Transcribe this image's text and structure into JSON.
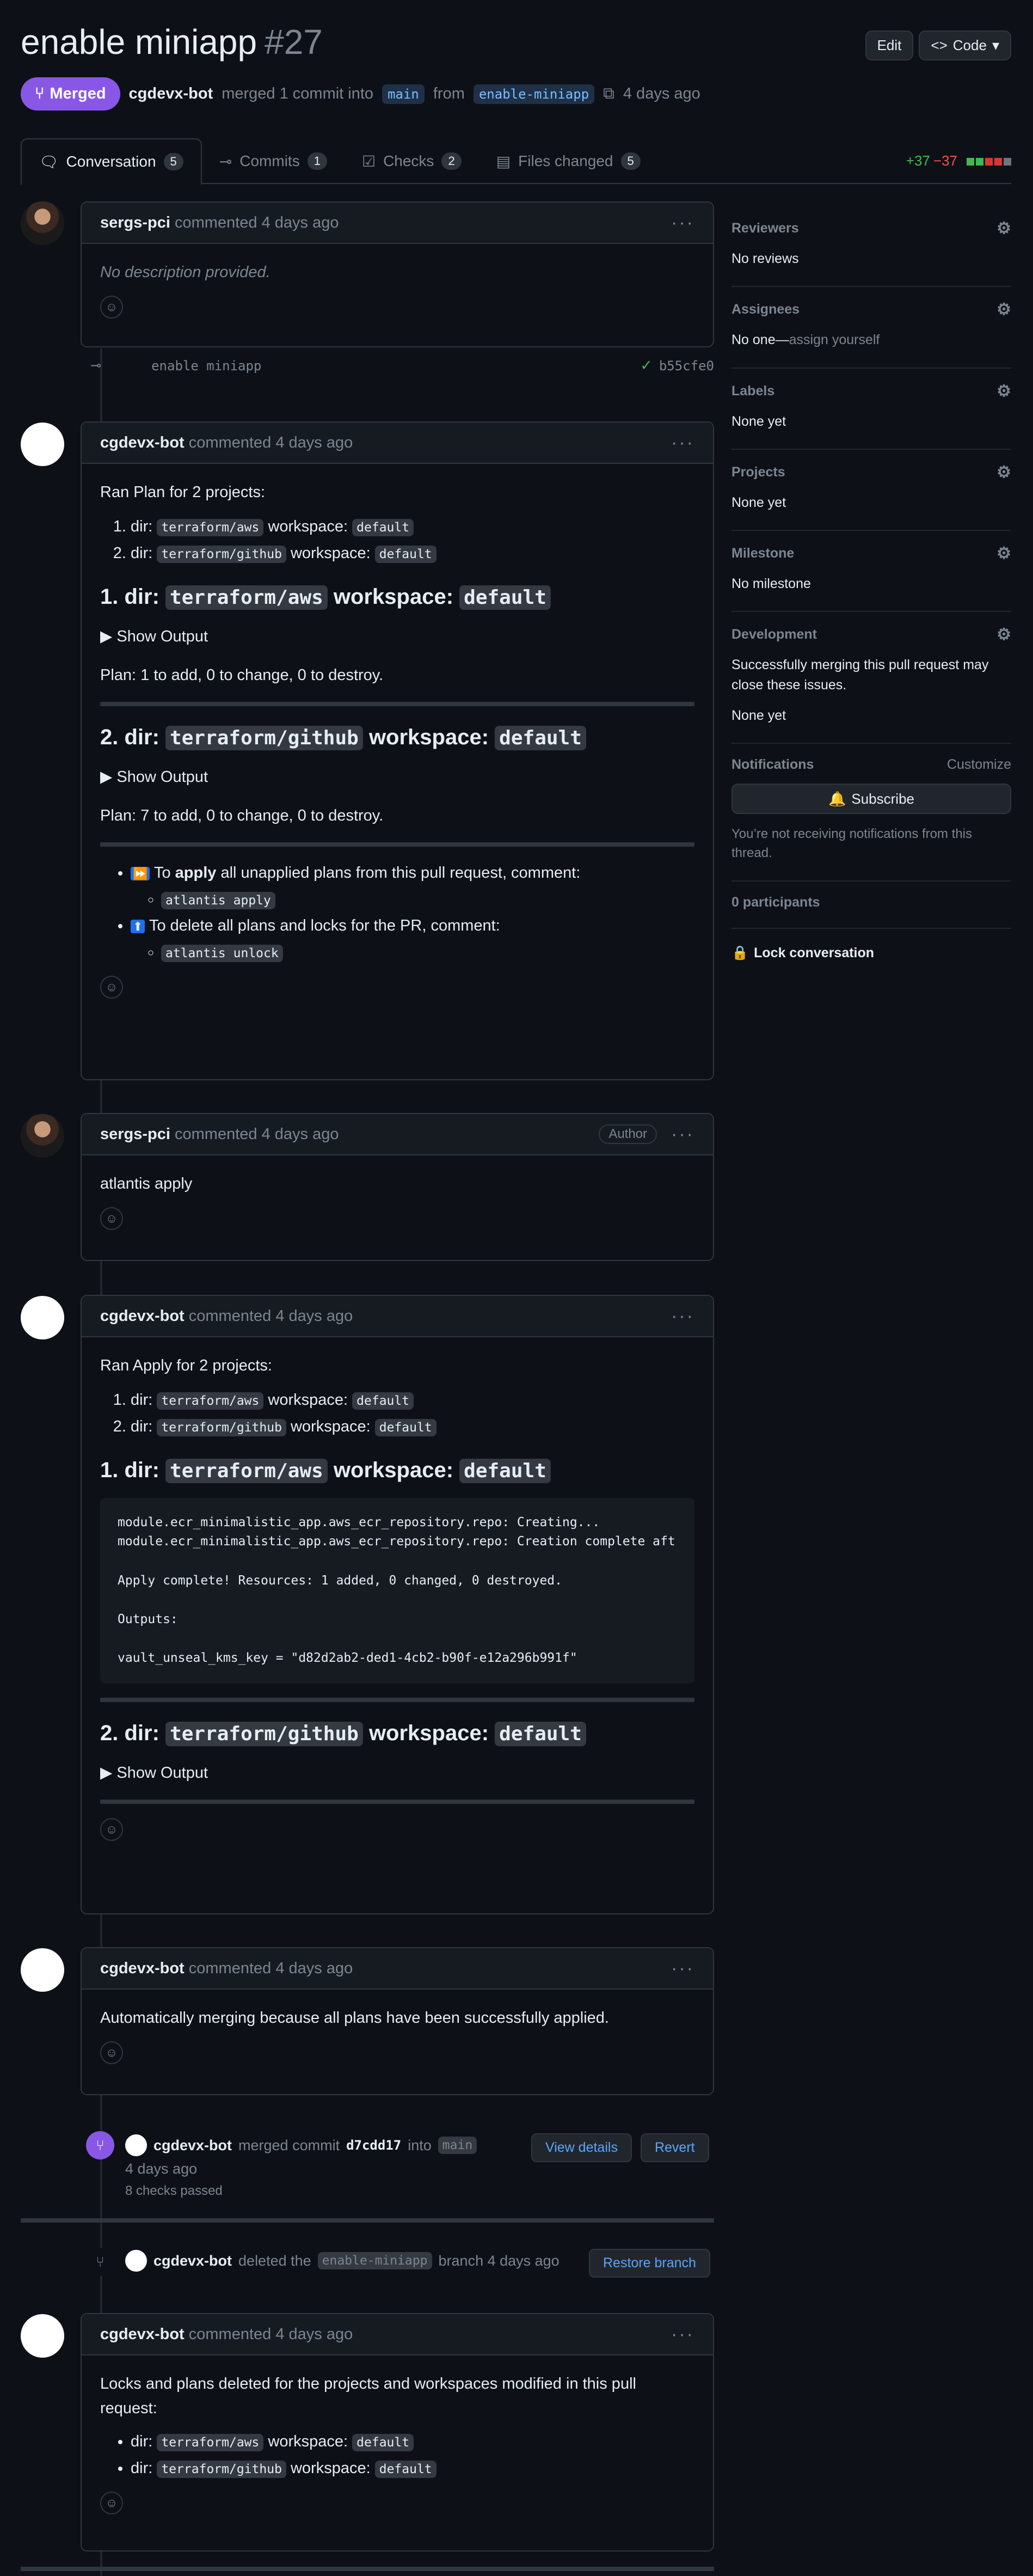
{
  "pr": {
    "title": "enable miniapp",
    "number": "#27",
    "status": "Merged",
    "author": "cgdevx-bot",
    "merged_text": "merged 1 commit into",
    "base": "main",
    "from_text": "from",
    "head": "enable-miniapp",
    "time": "4 days ago"
  },
  "header_buttons": {
    "edit": "Edit",
    "code": "Code"
  },
  "tabs": [
    {
      "label": "Conversation",
      "count": "5"
    },
    {
      "label": "Commits",
      "count": "1"
    },
    {
      "label": "Checks",
      "count": "2"
    },
    {
      "label": "Files changed",
      "count": "5"
    }
  ],
  "diffstat": {
    "additions": "+37",
    "deletions": "−37"
  },
  "colors": {
    "merged": "#8957e5",
    "added": "#3fb950",
    "removed": "#f85149",
    "link": "#58a6ff"
  },
  "comments": {
    "c1": {
      "author": "sergs-pci",
      "action": "commented",
      "time": "4 days ago",
      "body": "No description provided."
    },
    "commit": {
      "message": "enable miniapp",
      "sha": "b55cfe0"
    },
    "c2": {
      "author": "cgdevx-bot",
      "action": "commented",
      "time": "4 days ago",
      "intro": "Ran Plan for 2 projects:",
      "items": [
        {
          "pre": "dir:",
          "dir": "terraform/aws",
          "ws_label": "workspace:",
          "ws": "default"
        },
        {
          "pre": "dir:",
          "dir": "terraform/github",
          "ws_label": "workspace:",
          "ws": "default"
        }
      ],
      "h1": {
        "prefix": "1. dir:",
        "dir": "terraform/aws",
        "ws_label": "workspace:",
        "ws": "default"
      },
      "show1": "Show Output",
      "plan1": "Plan: 1 to add, 0 to change, 0 to destroy.",
      "h2": {
        "prefix": "2. dir:",
        "dir": "terraform/github",
        "ws_label": "workspace:",
        "ws": "default"
      },
      "show2": "Show Output",
      "plan2": "Plan: 7 to add, 0 to change, 0 to destroy.",
      "bullet1_pre": "To",
      "bullet1_bold": "apply",
      "bullet1_post": "all unapplied plans from this pull request, comment:",
      "bullet1_cmd": "atlantis apply",
      "bullet2": "To delete all plans and locks for the PR, comment:",
      "bullet2_cmd": "atlantis unlock"
    },
    "c3": {
      "author": "sergs-pci",
      "action": "commented",
      "time": "4 days ago",
      "badge": "Author",
      "body": "atlantis apply"
    },
    "c4": {
      "author": "cgdevx-bot",
      "action": "commented",
      "time": "4 days ago",
      "intro": "Ran Apply for 2 projects:",
      "items": [
        {
          "pre": "dir:",
          "dir": "terraform/aws",
          "ws_label": "workspace:",
          "ws": "default"
        },
        {
          "pre": "dir:",
          "dir": "terraform/github",
          "ws_label": "workspace:",
          "ws": "default"
        }
      ],
      "h1": {
        "prefix": "1. dir:",
        "dir": "terraform/aws",
        "ws_label": "workspace:",
        "ws": "default"
      },
      "pre": "module.ecr_minimalistic_app.aws_ecr_repository.repo: Creating...\nmodule.ecr_minimalistic_app.aws_ecr_repository.repo: Creation complete aft\n\nApply complete! Resources: 1 added, 0 changed, 0 destroyed.\n\nOutputs:\n\nvault_unseal_kms_key = \"d82d2ab2-ded1-4cb2-b90f-e12a296b991f\"",
      "h2": {
        "prefix": "2. dir:",
        "dir": "terraform/github",
        "ws_label": "workspace:",
        "ws": "default"
      },
      "show2": "Show Output"
    },
    "c5": {
      "author": "cgdevx-bot",
      "action": "commented",
      "time": "4 days ago",
      "body": "Automatically merging because all plans have been successfully applied."
    },
    "merge_event": {
      "author": "cgdevx-bot",
      "text": "merged commit",
      "sha": "d7cdd17",
      "into": "into",
      "base": "main",
      "time": "4 days ago",
      "checks": "8 checks passed",
      "view": "View details",
      "revert": "Revert"
    },
    "delete_event": {
      "author": "cgdevx-bot",
      "text1": "deleted the",
      "branch": "enable-miniapp",
      "text2": "branch 4 days ago",
      "restore": "Restore branch"
    },
    "c6": {
      "author": "cgdevx-bot",
      "action": "commented",
      "time": "4 days ago",
      "body": "Locks and plans deleted for the projects and workspaces modified in this pull request:",
      "items": [
        {
          "pre": "dir:",
          "dir": "terraform/aws",
          "ws_label": "workspace:",
          "ws": "default"
        },
        {
          "pre": "dir:",
          "dir": "terraform/github",
          "ws_label": "workspace:",
          "ws": "default"
        }
      ]
    }
  },
  "sidebar": {
    "reviewers": {
      "title": "Reviewers",
      "value": "No reviews"
    },
    "assignees": {
      "title": "Assignees",
      "value_pre": "No one—",
      "value_link": "assign yourself"
    },
    "labels": {
      "title": "Labels",
      "value": "None yet"
    },
    "projects": {
      "title": "Projects",
      "value": "None yet"
    },
    "milestone": {
      "title": "Milestone",
      "value": "No milestone"
    },
    "development": {
      "title": "Development",
      "text": "Successfully merging this pull request may close these issues.",
      "value": "None yet"
    },
    "notifications": {
      "title": "Notifications",
      "customize": "Customize",
      "subscribe": "Subscribe",
      "note": "You’re not receiving notifications from this thread."
    },
    "participants": "0 participants",
    "lock": "Lock conversation"
  }
}
